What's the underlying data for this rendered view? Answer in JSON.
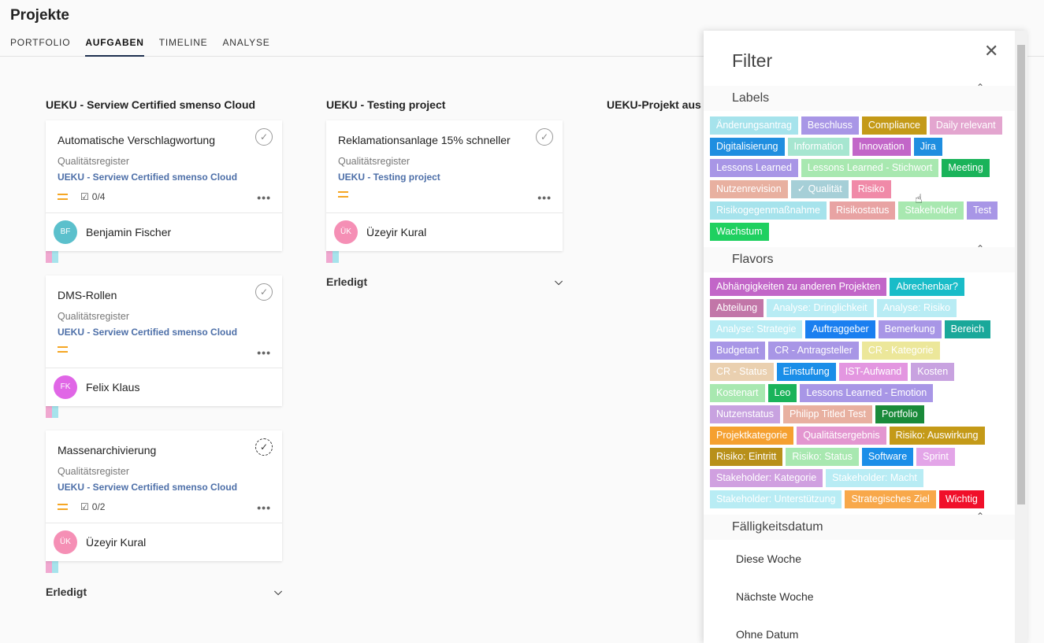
{
  "app": {
    "title": "Projekte",
    "tabs": [
      "PORTFOLIO",
      "AUFGABEN",
      "TIMELINE",
      "ANALYSE"
    ],
    "active_tab": "AUFGABEN"
  },
  "columns": [
    {
      "title": "UEKU - Serview Certified smenso Cloud",
      "cards": [
        {
          "title": "Automatische Verschlagwortung",
          "sub": "Qualitätsregister",
          "project": "UEKU - Serview Certified smenso Cloud",
          "checklist": "0/4",
          "assignee": "Benjamin Fischer",
          "initials": "BF",
          "avatar_color": "#5bc0cc",
          "done_icon": "✓"
        },
        {
          "title": "DMS-Rollen",
          "sub": "Qualitätsregister",
          "project": "UEKU - Serview Certified smenso Cloud",
          "checklist": "",
          "assignee": "Felix Klaus",
          "initials": "FK",
          "avatar_color": "#e066e6",
          "done_icon": "✓"
        },
        {
          "title": "Massenarchivierung",
          "sub": "Qualitätsregister",
          "project": "UEKU - Serview Certified smenso Cloud",
          "checklist": "0/2",
          "assignee": "Üzeyir Kural",
          "initials": "ÜK",
          "avatar_color": "#f58fb5",
          "done_icon": "✓"
        }
      ],
      "done_label": "Erledigt"
    },
    {
      "title": "UEKU - Testing project",
      "cards": [
        {
          "title": "Reklamationsanlage 15% schneller",
          "sub": "Qualitätsregister",
          "project": "UEKU - Testing project",
          "checklist": "",
          "assignee": "Üzeyir Kural",
          "initials": "ÜK",
          "avatar_color": "#f58fb5",
          "done_icon": "✓"
        }
      ],
      "done_label": "Erledigt"
    },
    {
      "title": "UEKU-Projekt aus Vo",
      "cards": []
    }
  ],
  "filter": {
    "title": "Filter",
    "close": "✕",
    "caret": "⌃",
    "labels_title": "Labels",
    "labels": [
      {
        "text": "Änderungsantrag",
        "color": "#a6e3ec"
      },
      {
        "text": "Beschluss",
        "color": "#a896e6"
      },
      {
        "text": "Compliance",
        "color": "#c49a18"
      },
      {
        "text": "Daily relevant",
        "color": "#e3a5cf"
      },
      {
        "text": "Digitalisierung",
        "color": "#1f8ee0"
      },
      {
        "text": "Information",
        "color": "#a6e6d0"
      },
      {
        "text": "Innovation",
        "color": "#c266c8"
      },
      {
        "text": "Jira",
        "color": "#1f8ee0"
      },
      {
        "text": "Lessons Learned",
        "color": "#a896e6"
      },
      {
        "text": "Lessons Learned - Stichwort",
        "color": "#a8e8b0"
      },
      {
        "text": "Meeting",
        "color": "#1ab35a"
      },
      {
        "text": "Nutzenrevision",
        "color": "#e8b0a0"
      },
      {
        "text": "✓  Qualität",
        "color": "#5fa8b8",
        "selected": true
      },
      {
        "text": "Risiko",
        "color": "#f08aa8"
      },
      {
        "text": "Risikogegenmaßnahme",
        "color": "#a6e3ec"
      },
      {
        "text": "Risikostatus",
        "color": "#e8a3a3"
      },
      {
        "text": "Stakeholder",
        "color": "#a8e8b0"
      },
      {
        "text": "Test",
        "color": "#a896e6"
      },
      {
        "text": "Wachstum",
        "color": "#1fd060"
      }
    ],
    "flavors_title": "Flavors",
    "flavors": [
      {
        "text": "Abhängigkeiten zu anderen Projekten",
        "color": "#c266c8"
      },
      {
        "text": "Abrechenbar?",
        "color": "#19bcc8"
      },
      {
        "text": "Abteilung",
        "color": "#c276a8"
      },
      {
        "text": "Analyse: Dringlichkeit",
        "color": "#b8ecf4"
      },
      {
        "text": "Analyse: Risiko",
        "color": "#b8ecf4"
      },
      {
        "text": "Analyse: Strategie",
        "color": "#b8ecf4"
      },
      {
        "text": "Auftraggeber",
        "color": "#1a7ff0"
      },
      {
        "text": "Bemerkung",
        "color": "#a896e6"
      },
      {
        "text": "Bereich",
        "color": "#1aa89a"
      },
      {
        "text": "Budgetart",
        "color": "#a896e6"
      },
      {
        "text": "CR - Antragsteller",
        "color": "#a896e6"
      },
      {
        "text": "CR - Kategorie",
        "color": "#ece79a"
      },
      {
        "text": "CR - Status",
        "color": "#ead0b0"
      },
      {
        "text": "Einstufung",
        "color": "#1a8ee8"
      },
      {
        "text": "IST-Aufwand",
        "color": "#e396e0"
      },
      {
        "text": "Kosten",
        "color": "#c8a2e0"
      },
      {
        "text": "Kostenart",
        "color": "#a8e8b0"
      },
      {
        "text": "Leo",
        "color": "#1ab35a"
      },
      {
        "text": "Lessons Learned - Emotion",
        "color": "#a896e6"
      },
      {
        "text": "Nutzenstatus",
        "color": "#c8a2e0"
      },
      {
        "text": "Philipp Titled Test",
        "color": "#e8b0a0"
      },
      {
        "text": "Portfolio",
        "color": "#1a8a3a"
      },
      {
        "text": "Projektkategorie",
        "color": "#f5a030"
      },
      {
        "text": "Qualitätsergebnis",
        "color": "#e396d0"
      },
      {
        "text": "Risiko: Auswirkung",
        "color": "#c49a18"
      },
      {
        "text": "Risiko: Eintritt",
        "color": "#b8901a"
      },
      {
        "text": "Risiko: Status",
        "color": "#a8e8b0"
      },
      {
        "text": "Software",
        "color": "#1a8ee8"
      },
      {
        "text": "Sprint",
        "color": "#e3a5e8"
      },
      {
        "text": "Stakeholder: Kategorie",
        "color": "#d0a0e0"
      },
      {
        "text": "Stakeholder: Macht",
        "color": "#b8ecf4"
      },
      {
        "text": "Stakeholder: Unterstützung",
        "color": "#b8ecf4"
      },
      {
        "text": "Strategisches Ziel",
        "color": "#f8a84a"
      },
      {
        "text": "Wichtig",
        "color": "#f0102a"
      }
    ],
    "date_title": "Fälligkeitsdatum",
    "date_options": [
      "Diese Woche",
      "Nächste Woche",
      "Ohne Datum"
    ]
  }
}
